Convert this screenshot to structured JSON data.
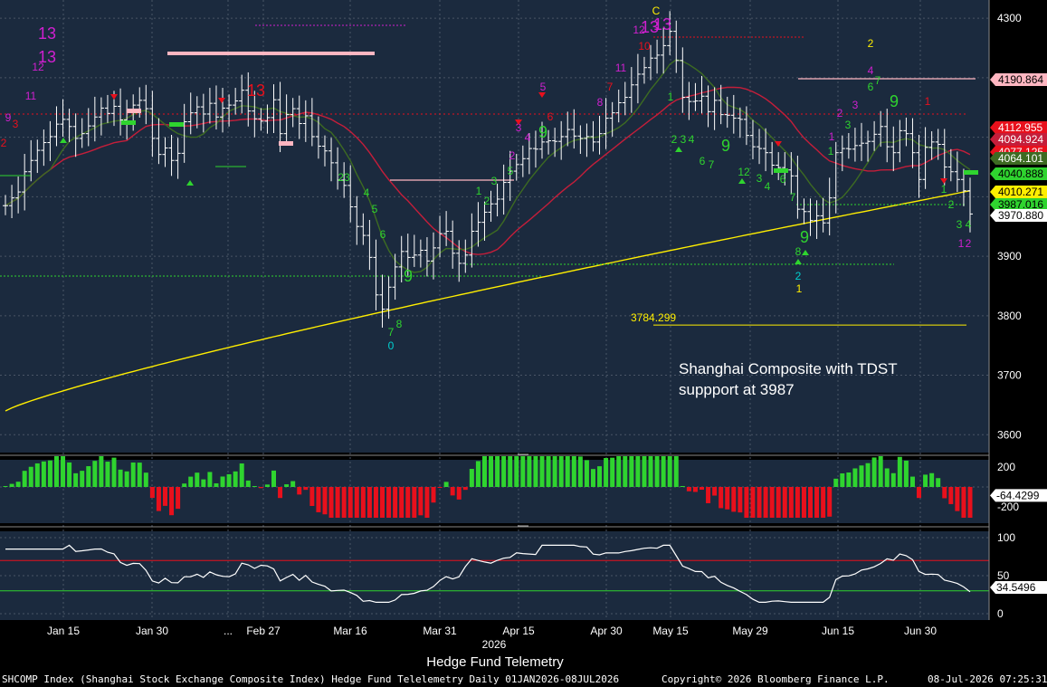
{
  "chart_data": {
    "type": "candlestick",
    "title": "Hedge Fund Telemetry",
    "annotation": "Shanghai Composite with TDST\nsuppport at 3987",
    "x_ticks": [
      "Jan 15",
      "Jan 30",
      "...",
      "Feb 27",
      "Mar 16",
      "Mar 31",
      "Apr 15",
      "Apr 30",
      "May 15",
      "May 29",
      "Jun 15",
      "Jun 30"
    ],
    "x_year": "2026",
    "price_axis": {
      "ticks": [
        3600,
        3700,
        3800,
        3900,
        4000,
        4100,
        4200,
        4300
      ],
      "ylim": [
        3570,
        4320
      ]
    },
    "price_tags": [
      {
        "label": "4190.864",
        "value": 4190.864,
        "color": "#ffb6c1",
        "text": "#000000"
      },
      {
        "label": "4112.955",
        "value": 4112.955,
        "color": "#e8101c",
        "text": "#ffffff"
      },
      {
        "label": "4094.924",
        "value": 4094.924,
        "color": "#c41e3a",
        "text": "#ffffff"
      },
      {
        "label": "4077.125",
        "value": 4077.125,
        "color": "#e8101c",
        "text": "#ffffff"
      },
      {
        "label": "4064.101",
        "value": 4064.101,
        "color": "#3d6b22",
        "text": "#ffffff"
      },
      {
        "label": "4040.888",
        "value": 4040.888,
        "color": "#2fd42f",
        "text": "#000000"
      },
      {
        "label": "4010.271",
        "value": 4010.271,
        "color": "#ffee00",
        "text": "#000000"
      },
      {
        "label": "3987.016",
        "value": 3987.016,
        "color": "#2fd42f",
        "text": "#000000"
      },
      {
        "label": "3970.880",
        "value": 3970.88,
        "color": "#ffffff",
        "text": "#000000"
      }
    ],
    "support_level": {
      "label": "3784.299",
      "value": 3784.299
    },
    "ohlc_close": [
      3985,
      3998,
      4008,
      4042,
      4061,
      4078,
      4091,
      4101,
      4122,
      4130,
      4118,
      4098,
      4106,
      4119,
      4134,
      4149,
      4140,
      4152,
      4129,
      4127,
      4154,
      4162,
      4148,
      4098,
      4071,
      4082,
      4061,
      4073,
      4126,
      4141,
      4151,
      4139,
      4157,
      4134,
      4149,
      4154,
      4161,
      4179,
      4144,
      4131,
      4127,
      4133,
      4163,
      4106,
      4138,
      4148,
      4123,
      4136,
      4101,
      4085,
      4077,
      4057,
      4028,
      4019,
      3983,
      3950,
      3935,
      3898,
      3835,
      3811,
      3848,
      3882,
      3908,
      3898,
      3902,
      3910,
      3892,
      3914,
      3938,
      3942,
      3905,
      3888,
      3902,
      3942,
      3957,
      3974,
      3988,
      3996,
      4024,
      4043,
      4054,
      4064,
      4081,
      4080,
      4092,
      4094,
      4093,
      4101,
      4113,
      4102,
      4098,
      4101,
      4092,
      4106,
      4132,
      4141,
      4158,
      4167,
      4188,
      4206,
      4217,
      4233,
      4238,
      4254,
      4278,
      4229,
      4167,
      4160,
      4161,
      4169,
      4143,
      4162,
      4138,
      4137,
      4132,
      4130,
      4103,
      4084,
      4081,
      4074,
      4053,
      4049,
      4045,
      4035,
      3979,
      3975,
      3960,
      3968,
      3956,
      3998,
      4074,
      4081,
      4080,
      4086,
      4090,
      4093,
      4105,
      4118,
      4084,
      4074,
      4111,
      4106,
      4074,
      4029,
      4083,
      4092,
      4088,
      4050,
      4042,
      4029,
      4010,
      3971
    ],
    "tdst_levels": [
      {
        "label": "tdst-resistance-feb",
        "value": 4281,
        "color": "#d020d0"
      },
      {
        "label": "tdst-resistance-may",
        "value": 4258,
        "color": "#e8101c"
      },
      {
        "label": "tdst-support",
        "value": 3987,
        "color": "#2fd42f"
      }
    ],
    "sequential_labels_top": [
      "13",
      "13",
      "13",
      "13",
      "13",
      "13"
    ],
    "sequential_labels_bottom": [
      "9",
      "9",
      "9",
      "9",
      "9",
      "9"
    ],
    "osc1": {
      "ticks": [
        200,
        -200
      ],
      "tag": "-64.4299",
      "tag_value": -64.4299
    },
    "osc2": {
      "ticks": [
        100,
        50,
        0
      ],
      "tag": "34.5496",
      "tag_value": 34.5496,
      "upper": 70,
      "lower": 30
    },
    "colors": {
      "bg": "#1b2a3e",
      "up": "#2fd42f",
      "down": "#e8101c",
      "ma_short": "#c41e3a",
      "ma_mid": "#3d6b22",
      "ma_long": "#ffee00",
      "bars": "#ffffff"
    }
  },
  "footer": {
    "left": "SHCOMP Index (Shanghai Stock Exchange Composite Index) Hedge Fund Telelemetry Daily 01JAN2026-08JUL2026",
    "center": "Copyright© 2026 Bloomberg Finance L.P.",
    "right": "08-Jul-2026 07:25:31"
  }
}
